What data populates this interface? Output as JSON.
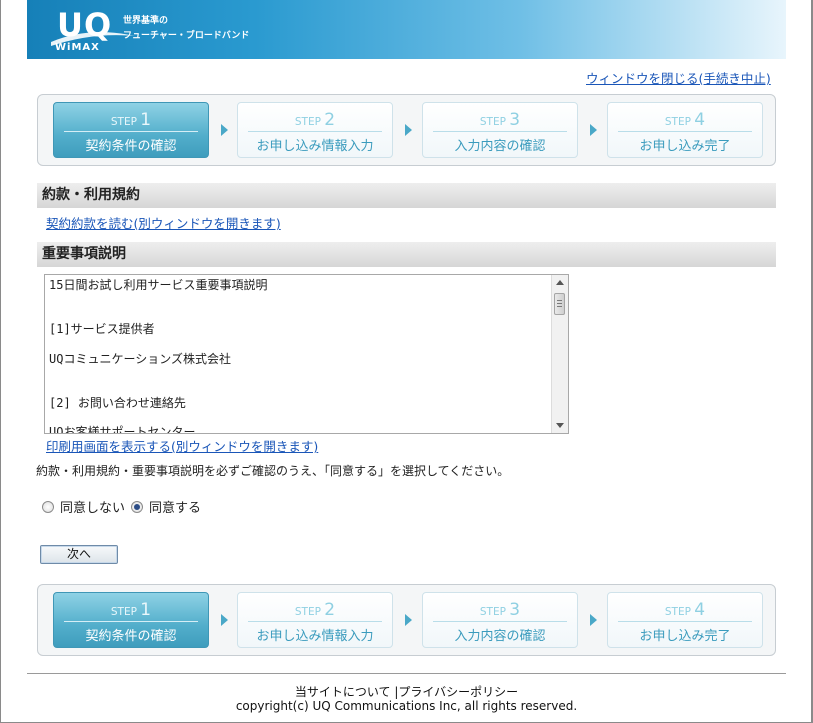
{
  "header": {
    "logo_main": "UQ",
    "logo_sub": "WiMAX",
    "tagline_line1": "世界基準の",
    "tagline_line2": "フューチャー・ブロードバンド"
  },
  "close_link": "ウィンドウを閉じる(手続き中止)",
  "steps": [
    {
      "prefix": "STEP",
      "num": "1",
      "label": "契約条件の確認"
    },
    {
      "prefix": "STEP",
      "num": "2",
      "label": "お申し込み情報入力"
    },
    {
      "prefix": "STEP",
      "num": "3",
      "label": "入力内容の確認"
    },
    {
      "prefix": "STEP",
      "num": "4",
      "label": "お申し込み完了"
    }
  ],
  "terms": {
    "heading": "約款・利用規約",
    "link": "契約約款を読む(別ウィンドウを開きます)"
  },
  "important": {
    "heading": "重要事項説明",
    "lines": [
      "15日間お試し利用サービス重要事項説明",
      "[1]サービス提供者",
      "UQコミュニケーションズ株式会社",
      "[2] お問い合わせ連絡先",
      "UQお客様サポートセンター"
    ],
    "print_link": "印刷用画面を表示する(別ウィンドウを開きます)"
  },
  "notice": "約款・利用規約・重要事項説明を必ずご確認のうえ、「同意する」を選択してください。",
  "consent": {
    "disagree": "同意しない",
    "agree": "同意する",
    "selected": "agree"
  },
  "next_button": "次へ",
  "footer": {
    "about": "当サイトについて",
    "separator": "|",
    "privacy": "プライバシーポリシー",
    "copyright": "copyright(c) UQ Communications Inc, all rights reserved."
  },
  "colors": {
    "header_blue": "#1680b8",
    "step_active": "#52aecb",
    "link": "#1a56b8"
  }
}
